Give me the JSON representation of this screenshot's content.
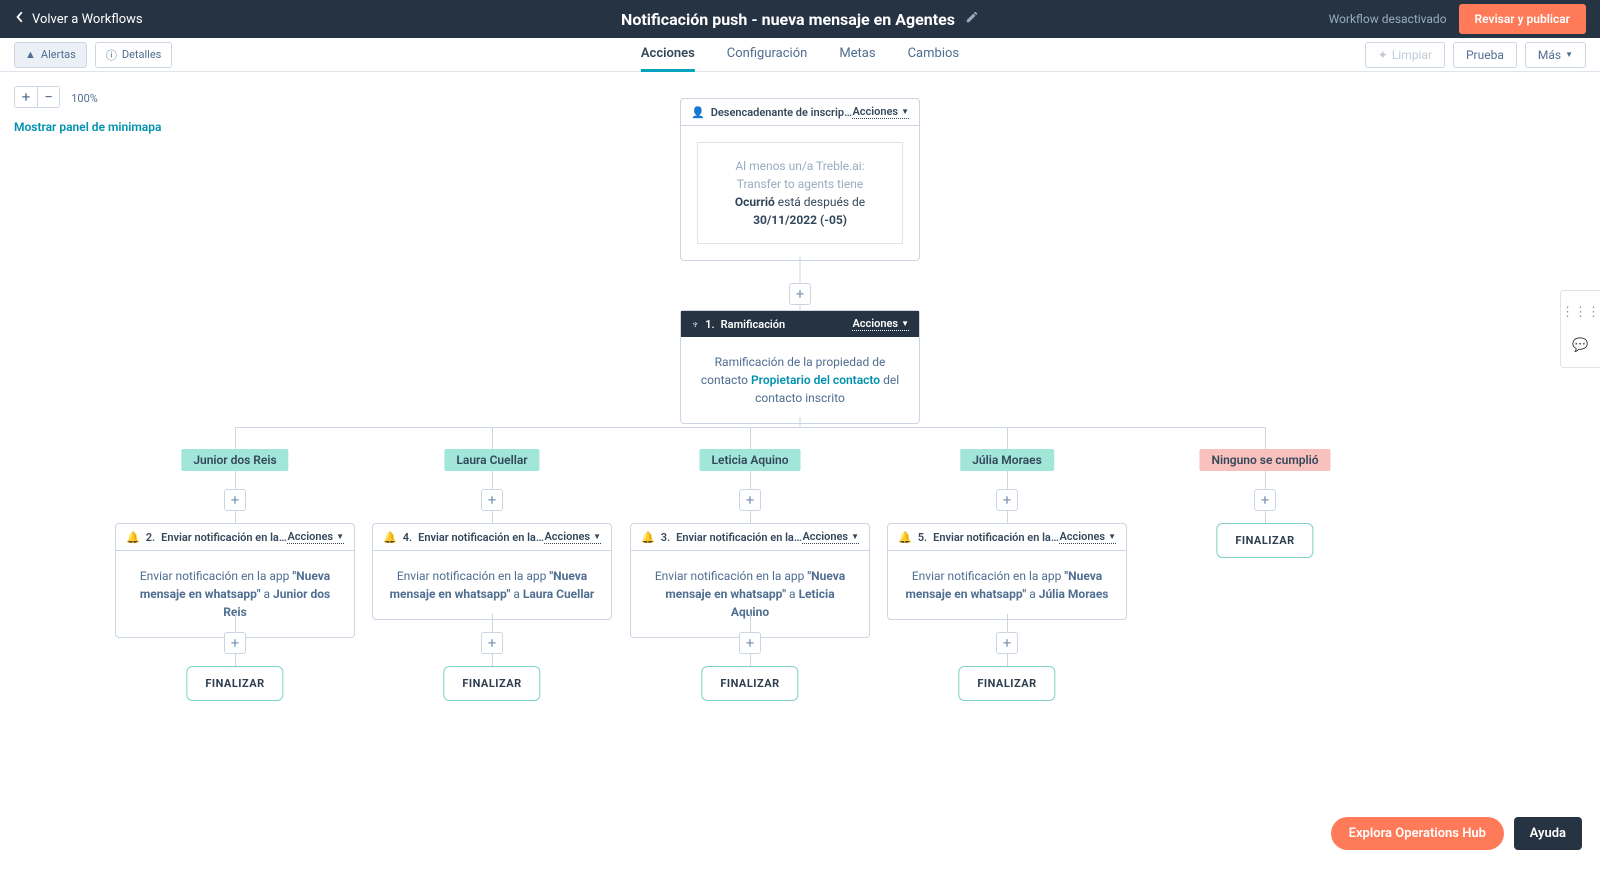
{
  "header": {
    "back": "Volver a Workflows",
    "title": "Notificación push - nueva mensaje en Agentes",
    "wf_off": "Workflow desactivado",
    "publish": "Revisar y publicar"
  },
  "subheader": {
    "alerts": "Alertas",
    "details": "Detalles",
    "tabs": [
      "Acciones",
      "Configuración",
      "Metas",
      "Cambios"
    ],
    "active_tab": 0,
    "clear": "Limpiar",
    "test": "Prueba",
    "more": "Más"
  },
  "tools": {
    "zoom": "100%",
    "minimap": "Mostrar panel de minimapa"
  },
  "trigger": {
    "title": "Desencadenante de inscripción…",
    "actions_label": "Acciones",
    "line1": "Al menos un/a Treble.ai: Transfer to agents tiene",
    "occurred": "Ocurrió",
    "after_text": " está después de ",
    "date": "30/11/2022 (-05)"
  },
  "branch": {
    "number": "1.",
    "title": "Ramificación",
    "actions_label": "Acciones",
    "desc_prefix": "Ramificación de la propiedad de contacto ",
    "link": "Propietario del contacto",
    "desc_suffix": " del contacto inscrito"
  },
  "finalize_label": "FINALIZAR",
  "none_label": "Ninguno se cumplió",
  "send_prefix": "Enviar notificación en la app ",
  "quote": "\"Nueva mensaje en whatsapp\"",
  "to": " a ",
  "actions_label": "Acciones",
  "columns": [
    {
      "name": "Junior dos Reis",
      "num": "2.",
      "title": "Enviar notificación en la app"
    },
    {
      "name": "Laura Cuellar",
      "num": "4.",
      "title": "Enviar notificación en la app"
    },
    {
      "name": "Leticia Aquino",
      "num": "3.",
      "title": "Enviar notificación en la app"
    },
    {
      "name": "Júlia Moraes",
      "num": "5.",
      "title": "Enviar notificación en la app"
    }
  ],
  "bottom": {
    "explore": "Explora Operations Hub",
    "help": "Ayuda"
  }
}
